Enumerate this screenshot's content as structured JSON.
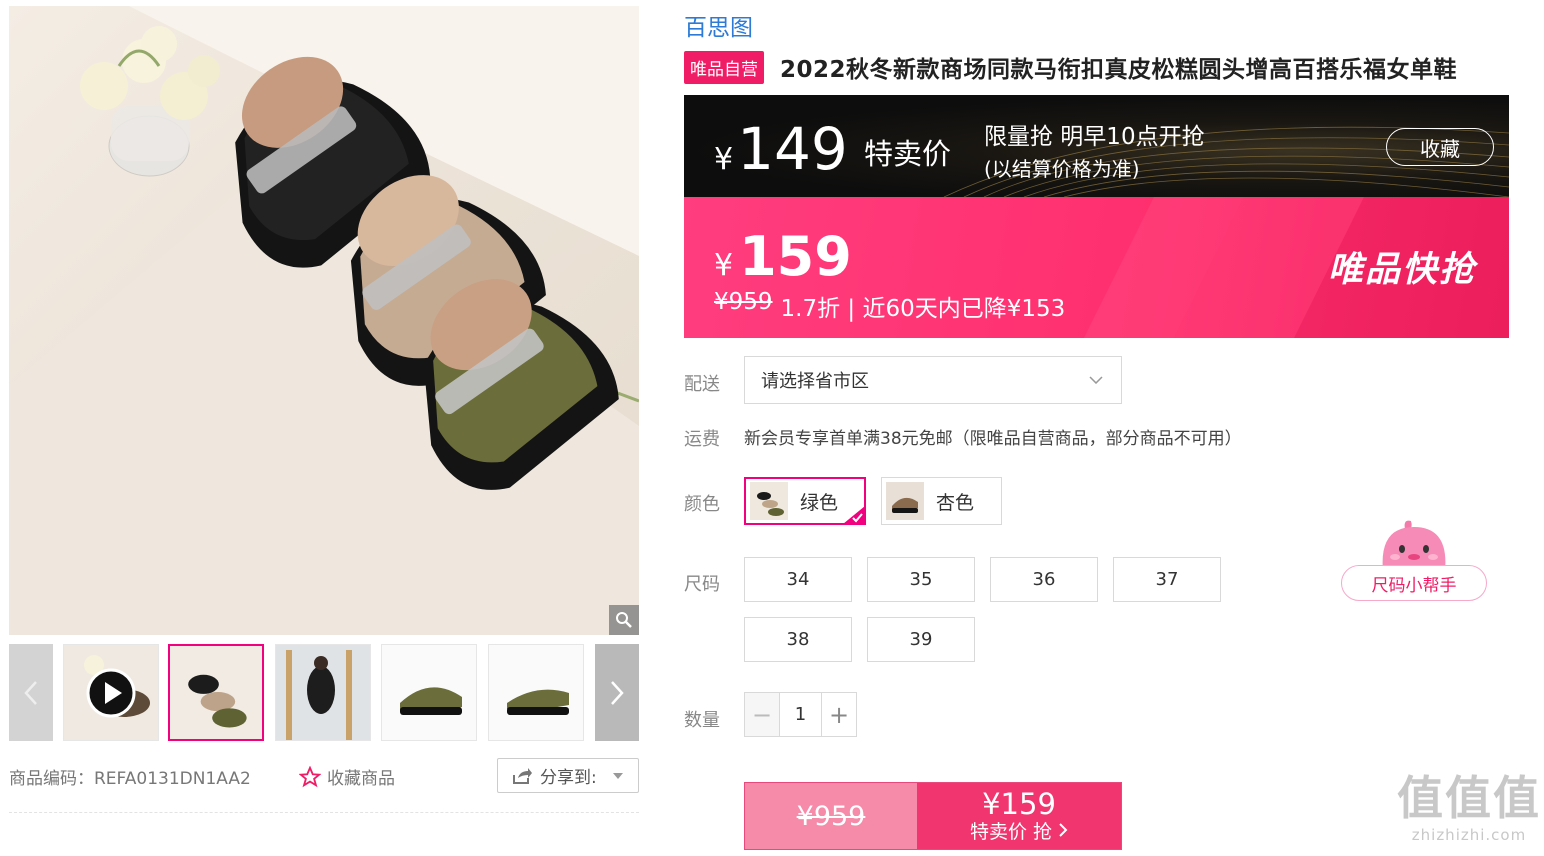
{
  "brand": "百思图",
  "title": {
    "badge": "唯品自营",
    "text": "2022秋冬新款商场同款马衔扣真皮松糕圆头增高百搭乐福女单鞋"
  },
  "flash_sale": {
    "currency": "¥",
    "price": "149",
    "label": "特卖价",
    "limit_text": "限量抢 明早10点开抢",
    "note": "(以结算价格为准)",
    "collect_label": "收藏"
  },
  "promo": {
    "currency": "¥",
    "price": "159",
    "original_price": "¥959",
    "discount_text": "1.7折 | 近60天内已降¥153",
    "badge": "唯品快抢"
  },
  "delivery": {
    "label": "配送",
    "placeholder": "请选择省市区"
  },
  "shipping": {
    "label": "运费",
    "text": "新会员专享首单满38元免邮（限唯品自营商品，部分商品不可用）"
  },
  "colors": {
    "label": "颜色",
    "options": [
      {
        "name": "绿色",
        "selected": true
      },
      {
        "name": "杏色",
        "selected": false
      }
    ]
  },
  "sizes": {
    "label": "尺码",
    "options": [
      "34",
      "35",
      "36",
      "37",
      "38",
      "39"
    ],
    "helper_label": "尺码小帮手"
  },
  "quantity": {
    "label": "数量",
    "value": "1",
    "minus": "−",
    "plus": "+"
  },
  "buy_button": {
    "original_price": "¥959",
    "price": "¥159",
    "label": "特卖价 抢"
  },
  "gallery": {
    "sku_label": "商品编码：REFA0131DN1AA2",
    "favorite_label": "收藏商品",
    "share_label": "分享到:",
    "thumbnail_count": 5,
    "active_thumbnail": 2
  },
  "watermark": {
    "big": "值值值",
    "small": "zhizhizhi.com"
  },
  "colors_theme": {
    "accent_pink": "#f01c66",
    "link_blue": "#2d7bd6",
    "promo_pink": "#ff2e6d",
    "flash_dark": "#111111"
  }
}
